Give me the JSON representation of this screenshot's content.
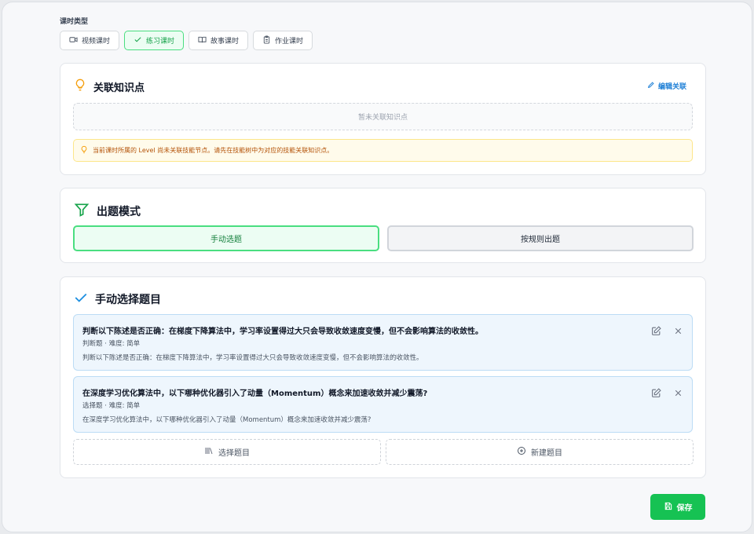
{
  "lesson_type": {
    "label": "课时类型",
    "options": [
      {
        "label": "视频课时",
        "icon": "video-icon",
        "active": false
      },
      {
        "label": "练习课时",
        "icon": "check-icon",
        "active": true
      },
      {
        "label": "故事课时",
        "icon": "book-icon",
        "active": false
      },
      {
        "label": "作业课时",
        "icon": "clipboard-icon",
        "active": false
      }
    ]
  },
  "knowledge": {
    "title": "关联知识点",
    "icon": "lightbulb-icon",
    "edit_label": "编辑关联",
    "empty_text": "暂未关联知识点",
    "warning": "当前课时所属的 Level 尚未关联技能节点。请先在技能树中为对应的技能关联知识点。"
  },
  "mode": {
    "title": "出题模式",
    "icon": "filter-icon",
    "options": [
      {
        "label": "手动选题",
        "active": true
      },
      {
        "label": "按规则出题",
        "active": false
      }
    ]
  },
  "manual": {
    "title": "手动选择题目",
    "icon": "check-icon",
    "questions": [
      {
        "title": "判断以下陈述是否正确：在梯度下降算法中，学习率设置得过大只会导致收敛速度变慢，但不会影响算法的收敛性。",
        "meta": "判断题 · 难度: 简单",
        "desc": "判断以下陈述是否正确：在梯度下降算法中，学习率设置得过大只会导致收敛速度变慢，但不会影响算法的收敛性。"
      },
      {
        "title": "在深度学习优化算法中，以下哪种优化器引入了动量（Momentum）概念来加速收敛并减少震荡?",
        "meta": "选择题 · 难度: 简单",
        "desc": "在深度学习优化算法中，以下哪种优化器引入了动量（Momentum）概念来加速收敛并减少震荡?"
      }
    ],
    "select_label": "选择题目",
    "new_label": "新建题目"
  },
  "save_label": "保存",
  "colors": {
    "green": "#16c253",
    "blue": "#1d7fd6",
    "amber": "#f59e0b"
  }
}
